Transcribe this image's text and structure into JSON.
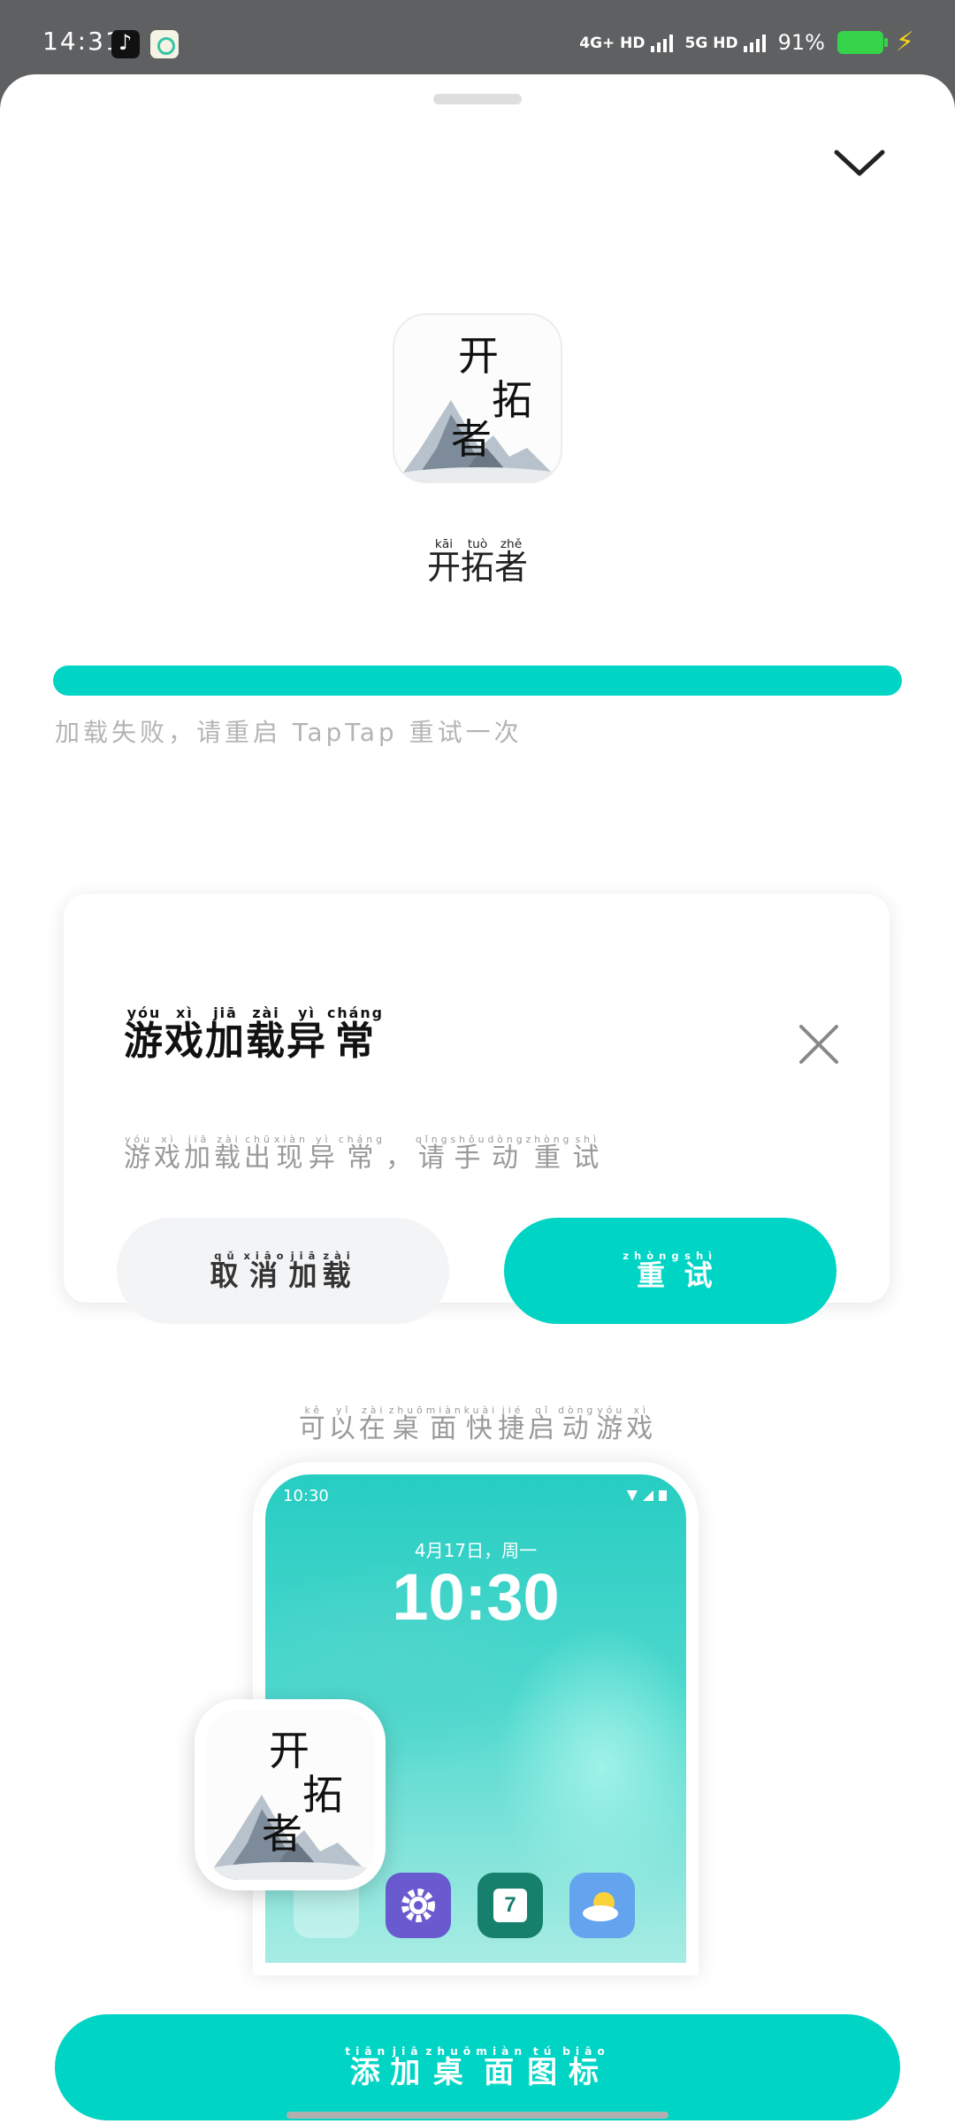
{
  "status_bar": {
    "time": "14:31",
    "network_1": "4G+ HD",
    "network_2": "5G HD",
    "battery_level": "91%",
    "notification_icons": [
      "tiktok-icon",
      "app-icon"
    ]
  },
  "game": {
    "icon_title_chars": [
      "开",
      "拓",
      "者"
    ],
    "name": [
      {
        "hz": "开",
        "py": "kāi"
      },
      {
        "hz": "拓",
        "py": "tuò"
      },
      {
        "hz": "者",
        "py": "zhě"
      }
    ]
  },
  "loading": {
    "progress": 1.0,
    "status_text": "加载失败，请重启 TapTap 重试一次"
  },
  "dialog": {
    "title": [
      {
        "hz": "游",
        "py": "yóu"
      },
      {
        "hz": "戏",
        "py": "xì"
      },
      {
        "hz": "加",
        "py": "jiā"
      },
      {
        "hz": "载",
        "py": "zài"
      },
      {
        "hz": "异",
        "py": "yì"
      },
      {
        "hz": "常",
        "py": "cháng"
      }
    ],
    "message": [
      {
        "hz": "游",
        "py": "yóu"
      },
      {
        "hz": "戏",
        "py": "xì"
      },
      {
        "hz": "加",
        "py": "jiā"
      },
      {
        "hz": "载",
        "py": "zài"
      },
      {
        "hz": "出",
        "py": "chū"
      },
      {
        "hz": "现",
        "py": "xiàn"
      },
      {
        "hz": "异",
        "py": "yì"
      },
      {
        "hz": "常",
        "py": "cháng"
      },
      {
        "hz": "，",
        "py": ""
      },
      {
        "hz": "请",
        "py": "qǐng"
      },
      {
        "hz": "手",
        "py": "shǒu"
      },
      {
        "hz": "动",
        "py": "dòng"
      },
      {
        "hz": "重",
        "py": "zhòng"
      },
      {
        "hz": "试",
        "py": "shì"
      }
    ],
    "cancel_label": [
      {
        "hz": "取",
        "py": "qǔ"
      },
      {
        "hz": "消",
        "py": "xiāo"
      },
      {
        "hz": "加",
        "py": "jiā"
      },
      {
        "hz": "载",
        "py": "zài"
      }
    ],
    "retry_label": [
      {
        "hz": "重",
        "py": "zhòng"
      },
      {
        "hz": "试",
        "py": "shì"
      }
    ]
  },
  "shortcut_promo": {
    "hint": [
      {
        "hz": "可",
        "py": "kě"
      },
      {
        "hz": "以",
        "py": "yǐ"
      },
      {
        "hz": "在",
        "py": "zài"
      },
      {
        "hz": "桌",
        "py": "zhuō"
      },
      {
        "hz": "面",
        "py": "miàn"
      },
      {
        "hz": "快",
        "py": "kuài"
      },
      {
        "hz": "捷",
        "py": "jié"
      },
      {
        "hz": "启",
        "py": "qǐ"
      },
      {
        "hz": "动",
        "py": "dòng"
      },
      {
        "hz": "游",
        "py": "yóu"
      },
      {
        "hz": "戏",
        "py": "xì"
      }
    ],
    "phone_time": "10:30",
    "phone_date": "4月17日，周一",
    "phone_clock": "10:30",
    "calendar_day": "7",
    "dock_icons": [
      "settings-icon",
      "calendar-icon",
      "weather-icon"
    ]
  },
  "add_button": [
    {
      "hz": "添",
      "py": "tiān"
    },
    {
      "hz": "加",
      "py": "jiā"
    },
    {
      "hz": "桌",
      "py": "zhuō"
    },
    {
      "hz": "面",
      "py": "miàn"
    },
    {
      "hz": "图",
      "py": "tú"
    },
    {
      "hz": "标",
      "py": "biāo"
    }
  ],
  "colors": {
    "accent": "#00d4c4",
    "status_bar_bg": "#5f6062",
    "muted_text": "#9a9a9a"
  }
}
